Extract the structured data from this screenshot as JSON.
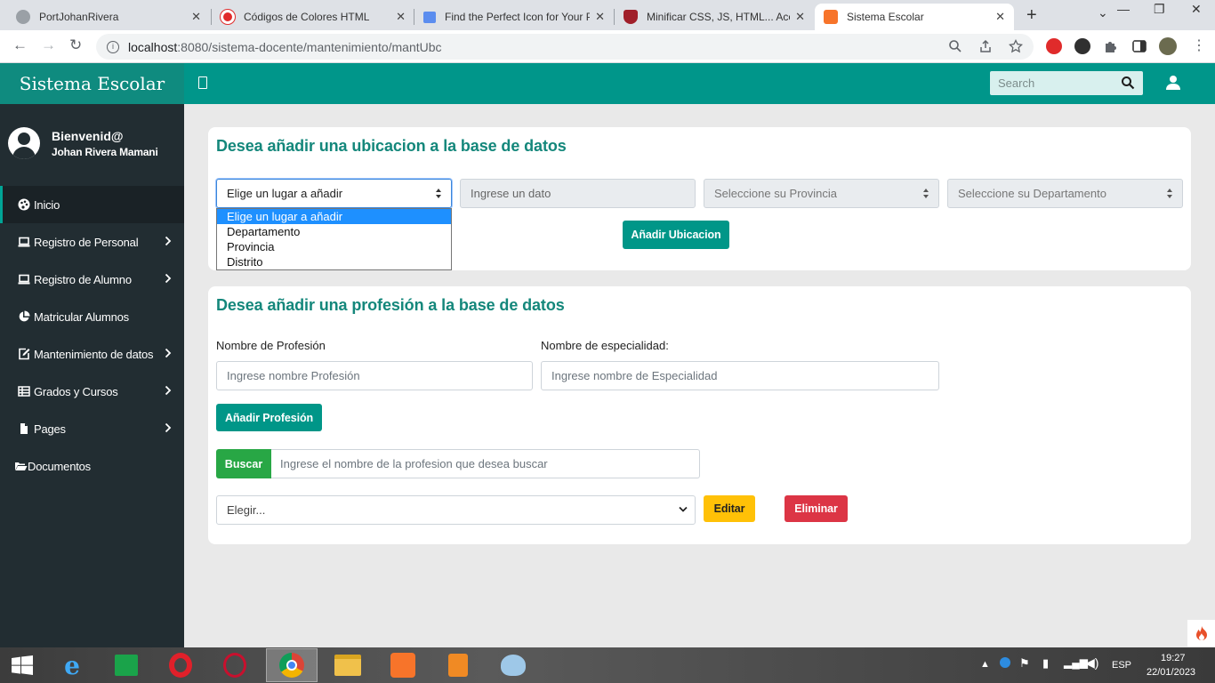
{
  "browser": {
    "tabs": [
      {
        "title": "PortJohanRivera",
        "active": false
      },
      {
        "title": "Códigos de Colores HTML",
        "active": false
      },
      {
        "title": "Find the Perfect Icon for Your P",
        "active": false
      },
      {
        "title": "Minificar CSS, JS, HTML... Acele",
        "active": false
      },
      {
        "title": "Sistema Escolar",
        "active": true
      }
    ],
    "url_host": "localhost",
    "url_path": ":8080/sistema-docente/mantenimiento/mantUbc"
  },
  "app": {
    "brand": "Sistema Escolar",
    "search_placeholder": "Search"
  },
  "sidebar": {
    "welcome": "Bienvenid@",
    "user_name": "Johan Rivera Mamani",
    "items": [
      {
        "label": "Inicio",
        "icon": "palette-icon",
        "has_chevron": false,
        "active": true
      },
      {
        "label": "Registro de Personal",
        "icon": "laptop-icon",
        "has_chevron": true
      },
      {
        "label": "Registro de Alumno",
        "icon": "laptop-icon",
        "has_chevron": true
      },
      {
        "label": "Matricular Alumnos",
        "icon": "pie-chart-icon",
        "has_chevron": false
      },
      {
        "label": "Mantenimiento de datos",
        "icon": "edit-icon",
        "has_chevron": true
      },
      {
        "label": "Grados y Cursos",
        "icon": "table-icon",
        "has_chevron": true
      },
      {
        "label": "Pages",
        "icon": "file-icon",
        "has_chevron": true
      },
      {
        "label": "Documentos",
        "icon": "folder-open-icon",
        "has_chevron": false
      }
    ]
  },
  "location_form": {
    "title": "Desea añadir una ubicacion a la base de datos",
    "place_select_value": "Elige un lugar a añadir",
    "place_options": [
      "Elige un lugar a añadir",
      "Departamento",
      "Provincia",
      "Distrito"
    ],
    "data_input_placeholder": "Ingrese un dato",
    "province_select_value": "Seleccione su Provincia",
    "department_select_value": "Seleccione su Departamento",
    "add_button": "Añadir Ubicacion"
  },
  "profession_form": {
    "title": "Desea añadir una profesión a la base de datos",
    "profession_label": "Nombre de Profesión",
    "profession_placeholder": "Ingrese nombre Profesión",
    "specialty_label": "Nombre de especialidad:",
    "specialty_placeholder": "Ingrese nombre de Especialidad",
    "add_button": "Añadir Profesión",
    "search_button": "Buscar",
    "search_placeholder": "Ingrese el nombre de la profesion que desea buscar",
    "choose_select_value": "Elegir...",
    "edit_button": "Editar",
    "delete_button": "Eliminar"
  },
  "taskbar": {
    "language": "ESP",
    "time": "19:27",
    "date": "22/01/2023"
  },
  "colors": {
    "brand": "#0f8b7f",
    "topnav": "#00968a",
    "sidebar": "#222d32",
    "title": "#14877b"
  }
}
